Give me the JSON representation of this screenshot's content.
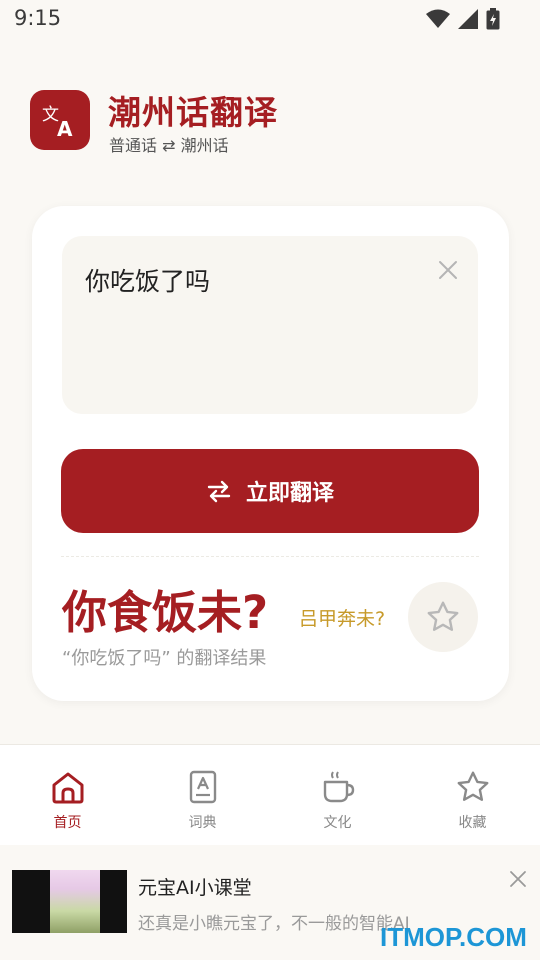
{
  "status_bar": {
    "time": "9:15"
  },
  "header": {
    "title": "潮州话翻译",
    "subtitle": "普通话 ⇄ 潮州话"
  },
  "input": {
    "value": "你吃饭了吗"
  },
  "translate_button": {
    "label": "立即翻译"
  },
  "result": {
    "text": "你食饭未?",
    "phonetic": "吕甲奔未?",
    "caption": "“你吃饭了吗” 的翻译结果"
  },
  "nav": {
    "items": [
      {
        "label": "首页",
        "icon": "home-icon",
        "active": true
      },
      {
        "label": "词典",
        "icon": "dictionary-icon",
        "active": false
      },
      {
        "label": "文化",
        "icon": "teacup-icon",
        "active": false
      },
      {
        "label": "收藏",
        "icon": "star-icon",
        "active": false
      }
    ]
  },
  "ad": {
    "title": "元宝AI小课堂",
    "description": "还真是小瞧元宝了，不一般的智能AI"
  },
  "watermark": "ITMOP.COM",
  "colors": {
    "accent": "#a51e22",
    "gold": "#c79a2a",
    "background": "#faf8f4"
  }
}
